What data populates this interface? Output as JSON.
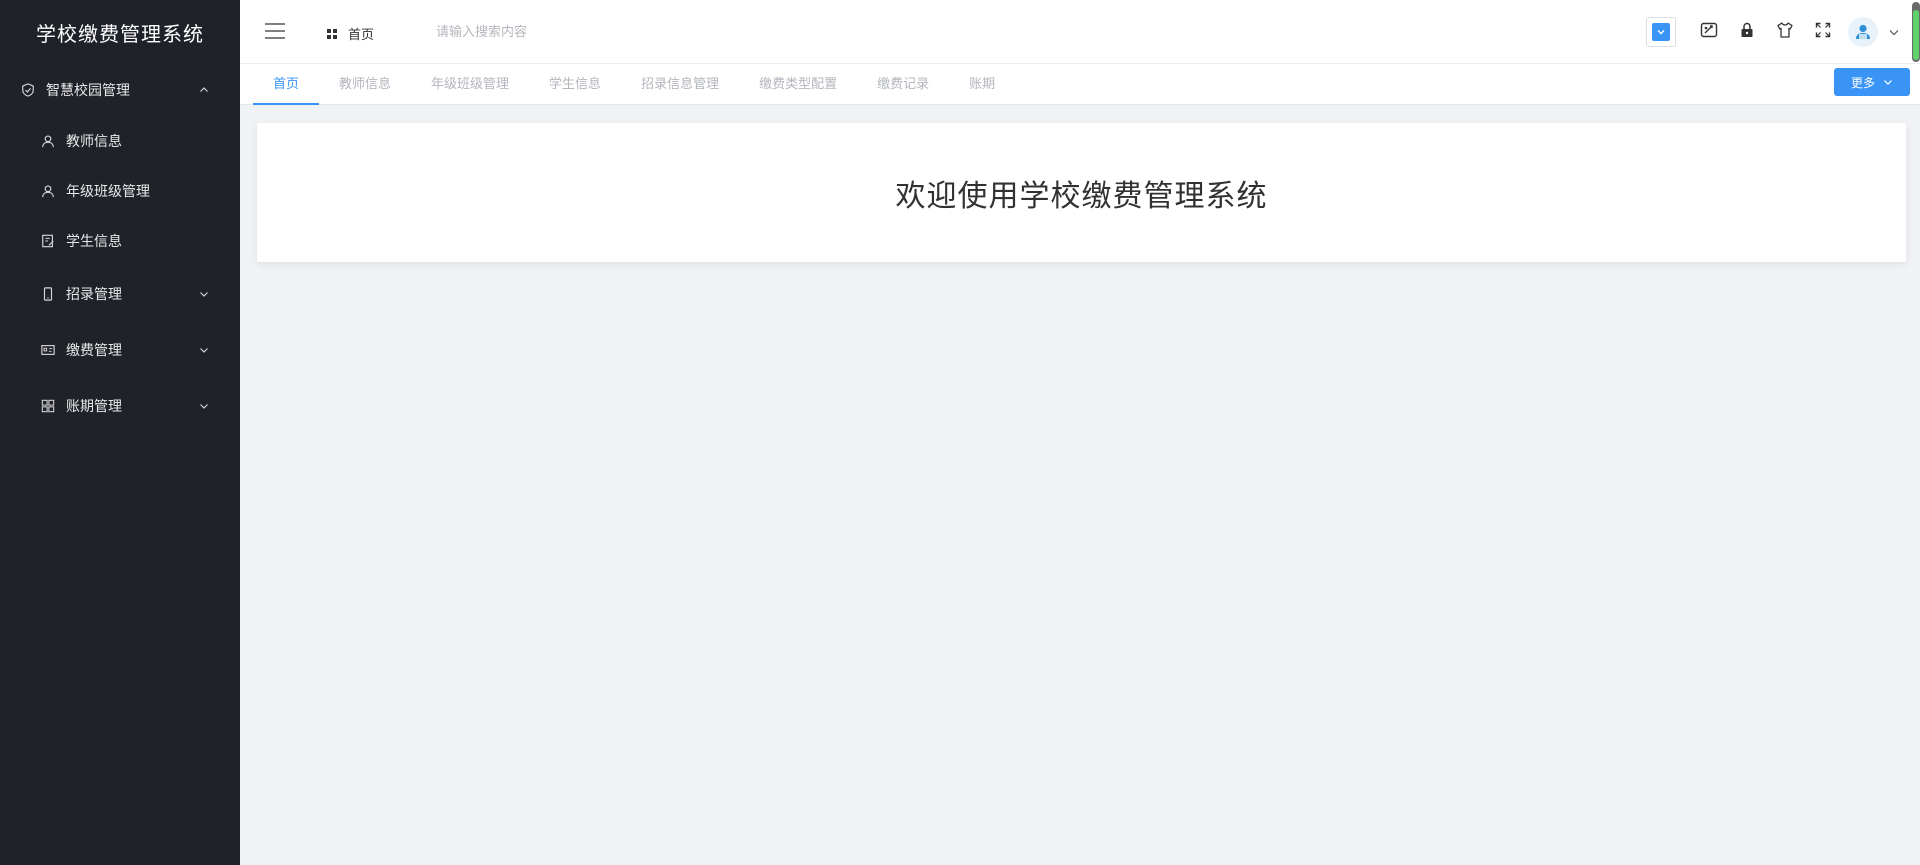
{
  "app": {
    "title": "学校缴费管理系统"
  },
  "sidebar": {
    "group": {
      "label": "智慧校园管理",
      "icon": "shield-check-icon",
      "expanded": true
    },
    "items": [
      {
        "label": "教师信息",
        "icon": "user-icon"
      },
      {
        "label": "年级班级管理",
        "icon": "user-icon"
      },
      {
        "label": "学生信息",
        "icon": "edit-document-icon"
      },
      {
        "label": "招录管理",
        "icon": "mobile-phone-icon",
        "expandable": true
      },
      {
        "label": "缴费管理",
        "icon": "id-card-icon",
        "expandable": true
      },
      {
        "label": "账期管理",
        "icon": "grid-icon",
        "expandable": true
      }
    ]
  },
  "header": {
    "breadcrumb": {
      "label": "首页",
      "icon": "grid-icon"
    },
    "search": {
      "placeholder": "请输入搜索内容",
      "value": ""
    },
    "tools": [
      "checkbox-icon",
      "screenshot-icon",
      "lock-icon",
      "shirt-icon",
      "fullscreen-icon",
      "avatar",
      "chevron-down-icon"
    ]
  },
  "tabs": {
    "items": [
      "首页",
      "教师信息",
      "年级班级管理",
      "学生信息",
      "招录信息管理",
      "缴费类型配置",
      "缴费记录",
      "账期"
    ],
    "active_index": 0,
    "more_label": "更多"
  },
  "main": {
    "welcome": "欢迎使用学校缴费管理系统"
  },
  "colors": {
    "sidebar_bg": "#20222a",
    "accent": "#3a94f5",
    "page_bg": "#f0f2f5"
  }
}
